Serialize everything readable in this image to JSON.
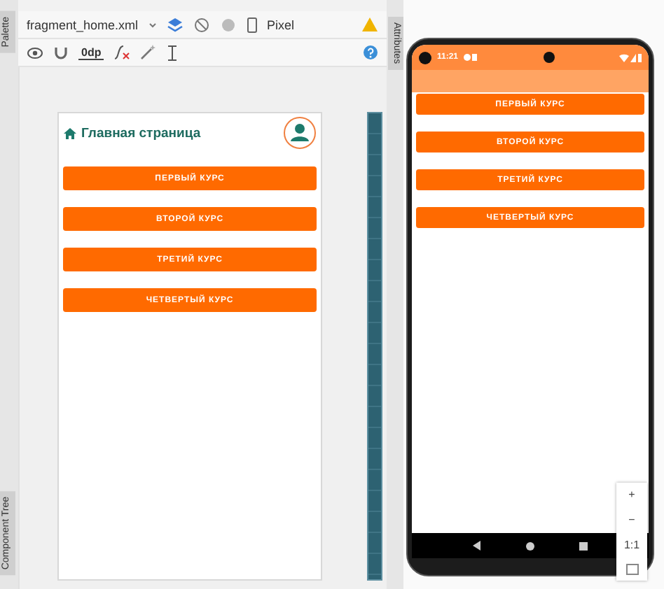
{
  "editor_toolbar": {
    "file_tab": "fragment_home.xml",
    "device": "Pixel",
    "margin_value": "0dp"
  },
  "side_tabs": [
    {
      "label": "Palette"
    },
    {
      "label": "Component Tree"
    }
  ],
  "attributes_tab": {
    "label": "Attributes"
  },
  "design_preview": {
    "title": "Главная страница",
    "buttons": [
      "ПЕРВЫЙ КУРС",
      "ВТОРОЙ КУРС",
      "ТРЕТИЙ КУРС",
      "ЧЕТВЕРТЫЙ КУРС"
    ]
  },
  "emulator": {
    "status_time": "11:21",
    "buttons": [
      "ПЕРВЫЙ КУРС",
      "ВТОРОЙ КУРС",
      "ТРЕТИЙ КУРС",
      "ЧЕТВЕРТЫЙ КУРС"
    ]
  },
  "zoom_controls": [
    "+",
    "−",
    "1:1"
  ]
}
